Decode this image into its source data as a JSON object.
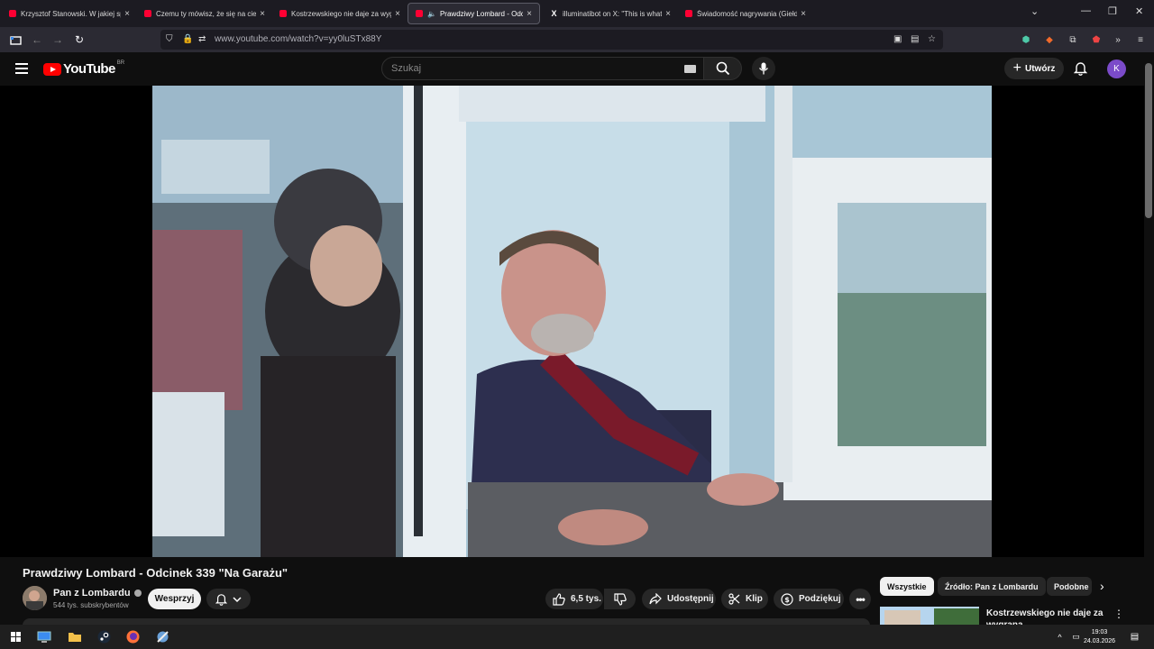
{
  "browser": {
    "tabs": [
      {
        "label": "Krzysztof Stanowski. W jakiej sp",
        "favicon": "youtube",
        "active": false
      },
      {
        "label": "Czemu ty mówisz, że się na cie",
        "favicon": "youtube",
        "active": false
      },
      {
        "label": "Kostrzewskiego nie daje za wyg",
        "favicon": "youtube",
        "active": false
      },
      {
        "label": "Prawdziwy Lombard - Odci",
        "favicon": "youtube",
        "active": true
      },
      {
        "label": "illuminatibot on X: \"This is what",
        "favicon": "x",
        "active": false
      },
      {
        "label": "Świadomość nagrywania (Giełd",
        "favicon": "youtube",
        "active": false
      }
    ],
    "url": "www.youtube.com/watch?v=yy0luSTx88Y"
  },
  "youtube": {
    "logo_text": "YouTube",
    "region": "BR",
    "search_placeholder": "Szukaj",
    "create_label": "Utwórz",
    "avatar_letter": "K"
  },
  "video": {
    "title": "Prawdziwy Lombard - Odcinek 339 \"Na Garażu\"",
    "channel": "Pan z Lombardu",
    "subscribers": "544 tys. subskrybentów",
    "support_label": "Wesprzyj",
    "likes": "6,5 tys.",
    "share_label": "Udostępnij",
    "clip_label": "Klip",
    "thanks_label": "Podziękuj"
  },
  "sidebar": {
    "chips": [
      "Wszystkie",
      "Źródło: Pan z Lombardu",
      "Podobne"
    ],
    "recommended": [
      {
        "title": "Kostrzewskiego nie daje za wygraną"
      }
    ]
  },
  "taskbar": {
    "time": "19:03",
    "date": "24.03.2026"
  },
  "colors": {
    "youtube_red": "#ff0000",
    "avatar_purple": "#7b4bc9",
    "browser_bg": "#2b2a33"
  }
}
